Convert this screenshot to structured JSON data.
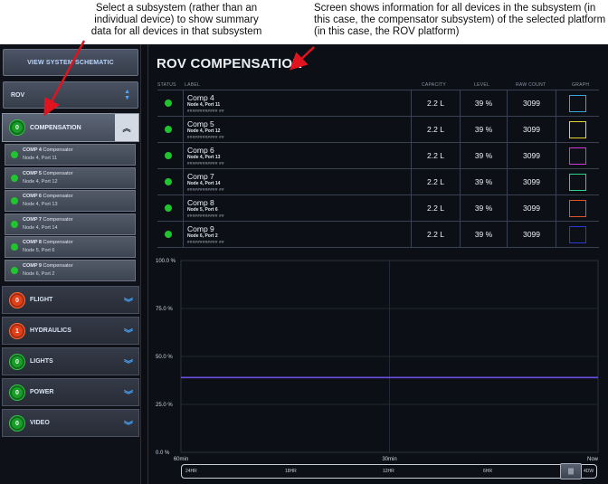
{
  "annotations": {
    "left": "Select a subsystem (rather than an individual device) to show summary data for all devices in that subsystem",
    "right": "Screen shows information for all devices in the subsystem (in this case, the compensator subsystem) of the selected platform (in this case, the ROV platform)"
  },
  "sidebar": {
    "schematic_button": "VIEW SYSTEM SCHEMATIC",
    "platform_select": "ROV",
    "expanded_subsystem": {
      "label": "COMPENSATION",
      "count": "0",
      "status_color": "#1a9e2a"
    },
    "devices": [
      {
        "name": "COMP 4",
        "type": "Compensator",
        "node": "Node 4, Port 11"
      },
      {
        "name": "COMP 5",
        "type": "Compensator",
        "node": "Node 4, Port 12"
      },
      {
        "name": "COMP 6",
        "type": "Compensator",
        "node": "Node 4, Port 13"
      },
      {
        "name": "COMP 7",
        "type": "Compensator",
        "node": "Node 4, Port 14"
      },
      {
        "name": "COMP 8",
        "type": "Compensator",
        "node": "Node 5, Port 6"
      },
      {
        "name": "COMP 9",
        "type": "Compensator",
        "node": "Node 6, Port 2"
      }
    ],
    "subsystems": [
      {
        "label": "FLIGHT",
        "count": "0",
        "status": "red"
      },
      {
        "label": "HYDRAULICS",
        "count": "1",
        "status": "red"
      },
      {
        "label": "LIGHTS",
        "count": "0",
        "status": "green"
      },
      {
        "label": "POWER",
        "count": "0",
        "status": "green"
      },
      {
        "label": "VIDEO",
        "count": "0",
        "status": "green"
      }
    ]
  },
  "main": {
    "title": "ROV COMPENSATION",
    "columns": {
      "status": "STATUS",
      "label": "LABEL",
      "capacity": "CAPACITY",
      "level": "LEVEL",
      "raw": "RAW COUNT",
      "graph": "GRAPH"
    },
    "rows": [
      {
        "name": "Comp 4",
        "node": "Node 4, Port 11",
        "hash": "############ ##",
        "capacity": "2.2 L",
        "level": "39 %",
        "raw": "3099",
        "graph_color": "#3aa6d8"
      },
      {
        "name": "Comp 5",
        "node": "Node 4, Port 12",
        "hash": "############ ##",
        "capacity": "2.2 L",
        "level": "39 %",
        "raw": "3099",
        "graph_color": "#e8d42a"
      },
      {
        "name": "Comp 6",
        "node": "Node 4, Port 13",
        "hash": "############ ##",
        "capacity": "2.2 L",
        "level": "39 %",
        "raw": "3099",
        "graph_color": "#d23ad8"
      },
      {
        "name": "Comp 7",
        "node": "Node 4, Port 14",
        "hash": "############ ##",
        "capacity": "2.2 L",
        "level": "39 %",
        "raw": "3099",
        "graph_color": "#2fd08a"
      },
      {
        "name": "Comp 8",
        "node": "Node 5, Port 6",
        "hash": "############ ##",
        "capacity": "2.2 L",
        "level": "39 %",
        "raw": "3099",
        "graph_color": "#e0552a"
      },
      {
        "name": "Comp 9",
        "node": "Node 6, Port 2",
        "hash": "############ ##",
        "capacity": "2.2 L",
        "level": "39 %",
        "raw": "3099",
        "graph_color": "#2a3ad8"
      }
    ],
    "time_range": {
      "labels": [
        "24HR",
        "18HR",
        "12HR",
        "6HR",
        "4DW"
      ],
      "thumb": "|||"
    }
  },
  "chart_data": {
    "type": "line",
    "title": "",
    "xlabel": "",
    "ylabel": "",
    "x_tick_labels": [
      "60min",
      "30min",
      "Now"
    ],
    "y_tick_labels": [
      "100.0 %",
      "75.0 %",
      "50.0 %",
      "25.0 %",
      "0.0 %"
    ],
    "ylim": [
      0,
      100
    ],
    "grid": true,
    "series": [
      {
        "values": [
          39,
          39,
          39,
          39,
          39,
          39,
          39
        ],
        "color": "#6a4ee0"
      }
    ]
  }
}
